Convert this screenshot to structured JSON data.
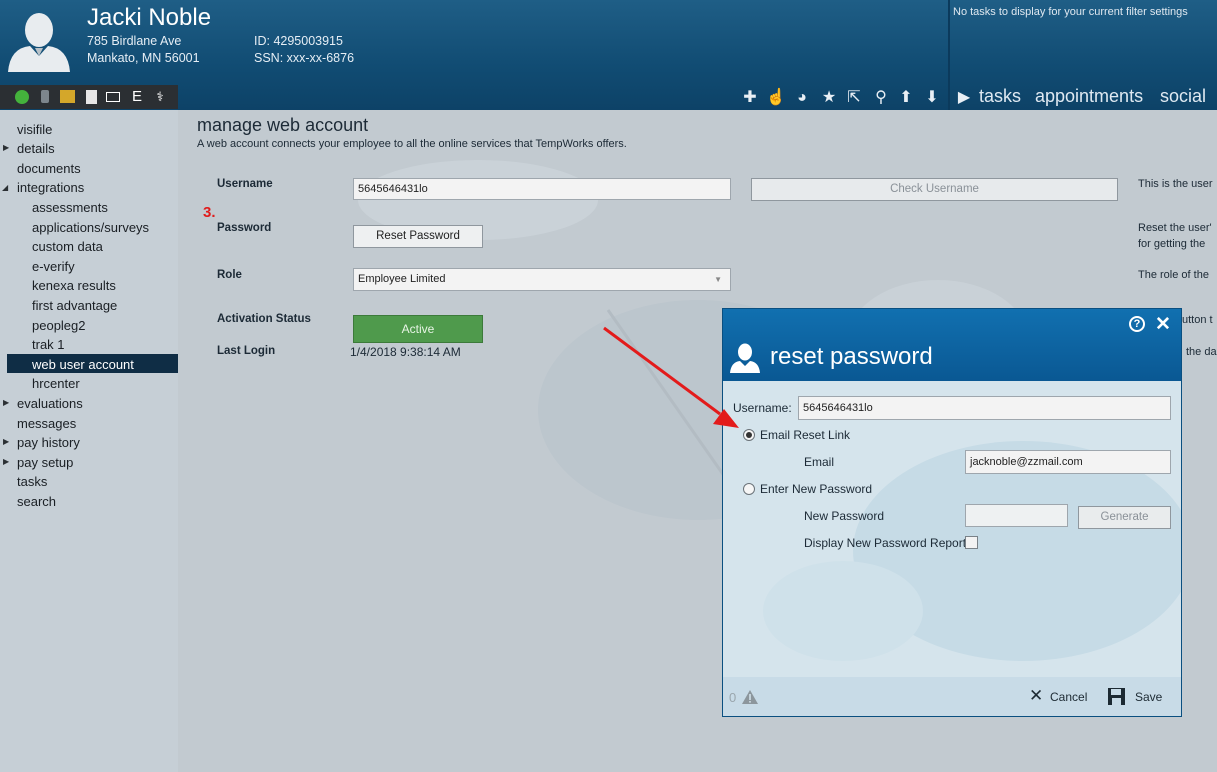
{
  "header": {
    "name": "Jacki Noble",
    "address1": "785 Birdlane Ave",
    "address2": "Mankato, MN 56001",
    "id": "ID: 4295003915",
    "ssn": "SSN: xxx-xx-6876",
    "tasks_message": "No tasks to display for your current filter settings",
    "tabs": [
      "tasks",
      "appointments",
      "social"
    ]
  },
  "sidebar": {
    "items": [
      {
        "label": "visifile"
      },
      {
        "label": "details"
      },
      {
        "label": "documents"
      },
      {
        "label": "integrations"
      },
      {
        "label": "assessments"
      },
      {
        "label": "applications/surveys"
      },
      {
        "label": "custom data"
      },
      {
        "label": "e-verify"
      },
      {
        "label": "kenexa results"
      },
      {
        "label": "first advantage"
      },
      {
        "label": "peopleg2"
      },
      {
        "label": "trak 1"
      },
      {
        "label": "web user account"
      },
      {
        "label": "hrcenter"
      },
      {
        "label": "evaluations"
      },
      {
        "label": "messages"
      },
      {
        "label": "pay history"
      },
      {
        "label": "pay setup"
      },
      {
        "label": "tasks"
      },
      {
        "label": "search"
      }
    ]
  },
  "main": {
    "title": "manage web account",
    "description": "A web account connects your employee to all the online services that TempWorks offers.",
    "step_marker": "3.",
    "username_label": "Username",
    "username_value": "5645646431lo",
    "check_username_button": "Check Username",
    "username_help": "This is the user",
    "password_label": "Password",
    "reset_password_button": "Reset Password",
    "password_help_1": "Reset the user'",
    "password_help_2": "for getting the",
    "role_label": "Role",
    "role_value": "Employee Limited",
    "role_help": "The role of the",
    "activation_label": "Activation Status",
    "activation_value": "Active",
    "activation_help": "utton t",
    "last_login_label": "Last Login",
    "last_login_value": "1/4/2018 9:38:14 AM",
    "last_login_help": "the da"
  },
  "modal": {
    "title": "reset password",
    "username_label": "Username:",
    "username_value": "5645646431lo",
    "email_reset_link_label": "Email Reset Link",
    "email_label": "Email",
    "email_value": "jacknoble@zzmail.com",
    "enter_new_password_label": "Enter New Password",
    "new_password_label": "New Password",
    "generate_button": "Generate",
    "display_report_label": "Display New Password Report",
    "warning_count": "0",
    "cancel_button": "Cancel",
    "save_button": "Save",
    "selected_option": "Email Reset Link"
  },
  "colors": {
    "header": "#114c73",
    "modal_header": "#0a5893",
    "active_nav": "#0f2d45",
    "active_status": "#4f9a4c",
    "step_marker": "#e01c1c",
    "arrow": "#e31b1b"
  }
}
